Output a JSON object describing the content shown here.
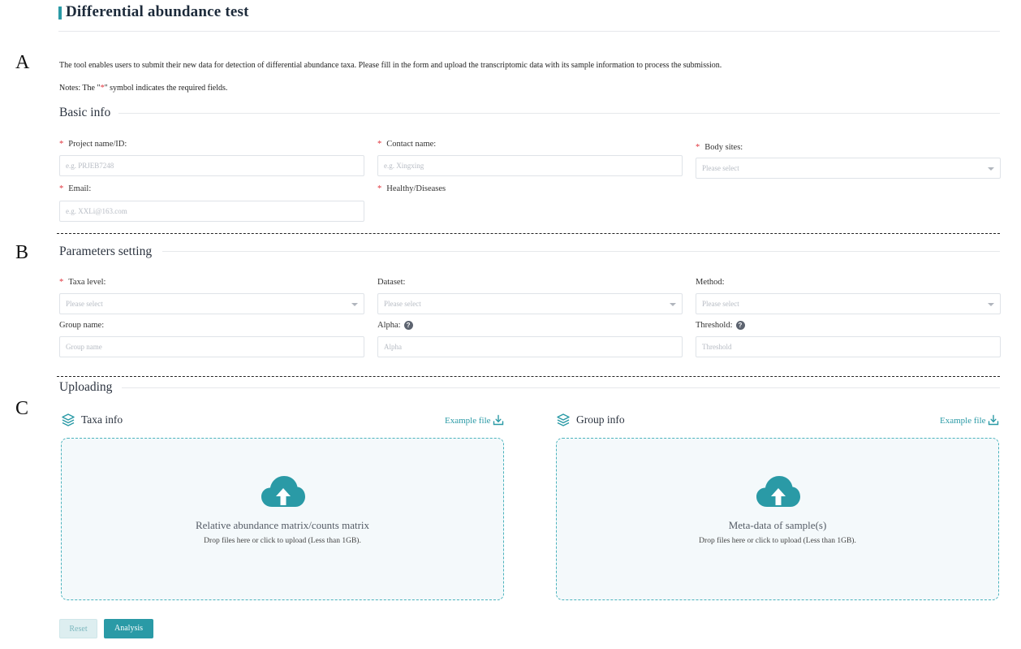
{
  "page": {
    "title": "Differential abundance test",
    "intro": "The tool enables users to submit their new data for detection of differential abundance taxa. Please fill in the form and upload the transcriptomic data with its sample information to process the submission.",
    "notes_prefix": "Notes: The \"",
    "notes_star": "*",
    "notes_suffix": "\" symbol indicates the required fields."
  },
  "markers": {
    "a": "A",
    "b": "B",
    "c": "C"
  },
  "basic": {
    "heading": "Basic info",
    "project_label": "Project name/ID:",
    "project_placeholder": "e.g. PRJEB7248",
    "contact_label": "Contact name:",
    "contact_placeholder": "e.g. Xingxing",
    "body_label": "Body sites:",
    "body_placeholder": "Please select",
    "email_label": "Email:",
    "email_placeholder": "e.g. XXLi@163.com",
    "health_label": "Healthy/Diseases"
  },
  "params": {
    "heading": "Parameters setting",
    "taxa_label": "Taxa level:",
    "taxa_placeholder": "Please select",
    "dataset_label": "Dataset:",
    "dataset_placeholder": "Please select",
    "method_label": "Method:",
    "method_placeholder": "Please select",
    "group_label": "Group name:",
    "group_placeholder": "Group name",
    "alpha_label": "Alpha:",
    "alpha_placeholder": "Alpha",
    "threshold_label": "Threshold:",
    "threshold_placeholder": "Threshold",
    "help_glyph": "?"
  },
  "upload": {
    "heading": "Uploading",
    "taxa": {
      "title": "Taxa info",
      "example": "Example file",
      "main": "Relative abundance matrix/counts matrix",
      "sub": "Drop files here or click to upload (Less than 1GB)."
    },
    "group": {
      "title": "Group info",
      "example": "Example file",
      "main": "Meta-data of sample(s)",
      "sub": "Drop files here or click to upload (Less than 1GB)."
    }
  },
  "buttons": {
    "reset": "Reset",
    "analysis": "Analysis"
  },
  "colors": {
    "accent": "#2a9aa6",
    "required": "#e0343c",
    "dropzone_bg": "#f4f9fb"
  }
}
